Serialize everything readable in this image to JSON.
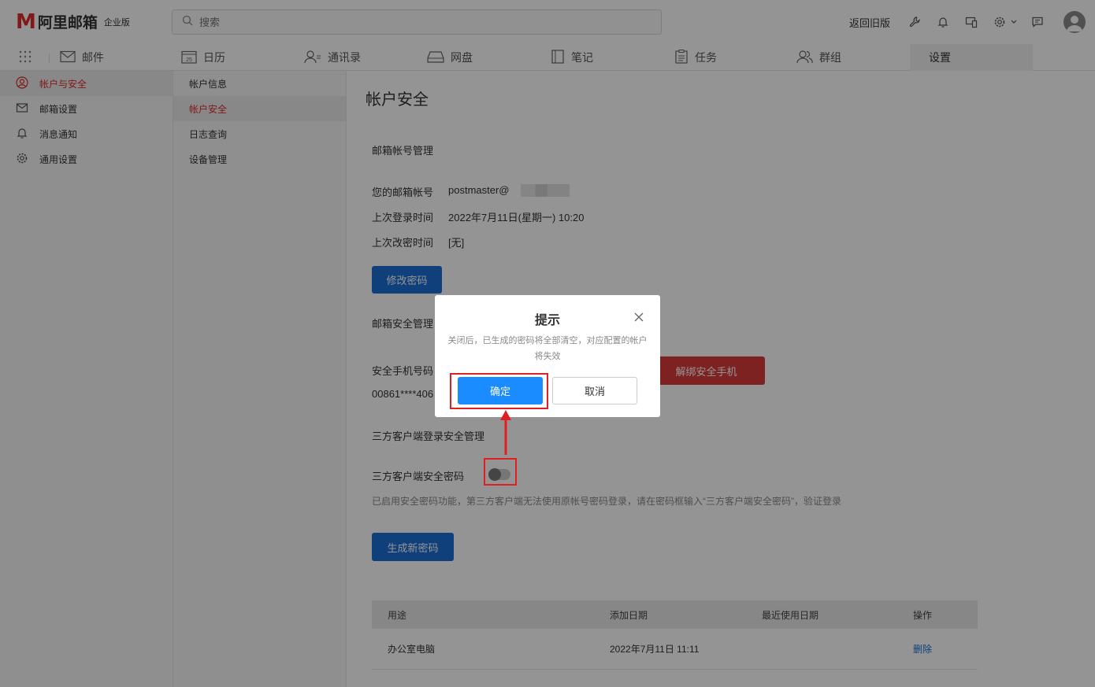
{
  "topbar": {
    "logo_mark": "M",
    "logo_name": "阿里邮箱",
    "logo_edition": "企业版",
    "search_placeholder": "搜索",
    "back_old_label": "返回旧版"
  },
  "nav": {
    "tabs": [
      {
        "label": "邮件",
        "icon": "mail-icon"
      },
      {
        "label": "日历",
        "icon": "calendar-icon",
        "badge": "25"
      },
      {
        "label": "通讯录",
        "icon": "contacts-icon"
      },
      {
        "label": "网盘",
        "icon": "drive-icon"
      },
      {
        "label": "笔记",
        "icon": "notes-icon"
      },
      {
        "label": "任务",
        "icon": "tasks-icon"
      },
      {
        "label": "群组",
        "icon": "groups-icon"
      },
      {
        "label": "设置",
        "icon": "",
        "active": true
      }
    ]
  },
  "sidebar": {
    "items": [
      {
        "label": "帐户与安全",
        "icon": "user-icon",
        "active": true
      },
      {
        "label": "邮箱设置",
        "icon": "mail-icon"
      },
      {
        "label": "消息通知",
        "icon": "bell-icon"
      },
      {
        "label": "通用设置",
        "icon": "gear-icon"
      }
    ]
  },
  "submenu": {
    "items": [
      {
        "label": "帐户信息"
      },
      {
        "label": "帐户安全",
        "active": true
      },
      {
        "label": "日志查询"
      },
      {
        "label": "设备管理"
      }
    ]
  },
  "main": {
    "title": "帐户安全",
    "account_section": "邮箱帐号管理",
    "email_label": "您的邮箱帐号",
    "email_value": "postmaster@",
    "last_login_label": "上次登录时间",
    "last_login_value": "2022年7月11日(星期一) 10:20",
    "last_pwd_label": "上次改密时间",
    "last_pwd_value": "[无]",
    "change_pwd_button": "修改密码",
    "security_section": "邮箱安全管理",
    "phone_label": "安全手机号码",
    "phone_value": "00861****406",
    "unbind_button": "解绑安全手机",
    "third_party_section": "三方客户端登录安全管理",
    "third_party_pwd_label": "三方客户端安全密码",
    "hint": "已启用安全密码功能，第三方客户端无法使用原帐号密码登录，请在密码框输入“三方客户端安全密码”，验证登录",
    "generate_button": "生成新密码",
    "table": {
      "headers": [
        "用途",
        "添加日期",
        "最近使用日期",
        "操作"
      ],
      "rows": [
        {
          "purpose": "办公室电脑",
          "added": "2022年7月11日 11:11",
          "last_used": "",
          "action": "删除"
        }
      ]
    }
  },
  "dialog": {
    "title": "提示",
    "message": "关闭后，已生成的密码将全部清空，对应配置的帐户将失效",
    "ok_label": "确定",
    "cancel_label": "取消"
  },
  "colors": {
    "brand_red": "#e02b2b",
    "primary_blue": "#1a6fd6",
    "dialog_blue": "#1a8cff",
    "annotation_red": "#e02020"
  }
}
